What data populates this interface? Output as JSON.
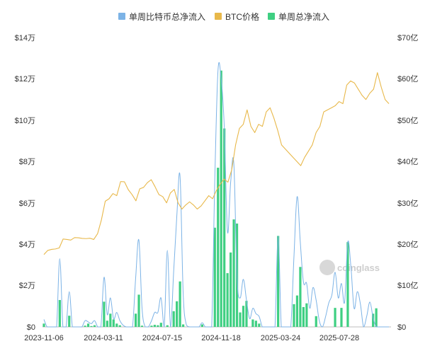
{
  "chart_data": {
    "type": "bar",
    "legend": [
      {
        "name": "单周比特币总净流入",
        "color": "#7cb3e6"
      },
      {
        "name": "BTC价格",
        "color": "#e8b84a"
      },
      {
        "name": "单周总净流入",
        "color": "#3fcf82"
      }
    ],
    "legend_position": "top-center",
    "grid": false,
    "x_tick_labels": [
      "2023-11-06",
      "2024-03-11",
      "2024-07-15",
      "2024-11-18",
      "2025-03-24",
      "2025-07-28"
    ],
    "x_tick_weeks": [
      0,
      18,
      36,
      54,
      72,
      90
    ],
    "weeks": 110,
    "y_left": {
      "min": 0,
      "max": 140000,
      "ticks": [
        0,
        20000,
        40000,
        60000,
        80000,
        100000,
        120000,
        140000
      ],
      "tick_labels": [
        "$0",
        "$2万",
        "$4万",
        "$6万",
        "$8万",
        "$10万",
        "$12万",
        "$14万"
      ]
    },
    "y_right": {
      "min": 0,
      "max": 70,
      "ticks": [
        0,
        10,
        20,
        30,
        40,
        50,
        60,
        70
      ],
      "tick_labels": [
        "$0",
        "$10亿",
        "$20亿",
        "$30亿",
        "$40亿",
        "$50亿",
        "$60亿",
        "$70亿"
      ]
    },
    "series": [
      {
        "name": "单周总净流入",
        "axis": "right",
        "values": [
          0.8,
          0,
          0,
          0,
          0,
          6.5,
          0,
          0,
          2.7,
          0,
          0,
          0,
          0,
          0.3,
          0.8,
          0.2,
          0.4,
          0,
          0,
          6.1,
          1.5,
          3.2,
          1.8,
          0.8,
          0.4,
          0,
          0,
          0,
          0,
          3.2,
          7.8,
          0.3,
          0,
          0,
          0.3,
          0.5,
          0.4,
          1,
          0,
          0.4,
          0,
          3.8,
          6.2,
          11,
          0.6,
          0,
          0,
          0,
          0,
          0,
          0.6,
          0,
          0,
          0,
          24,
          38.5,
          62,
          48,
          13,
          18,
          26,
          25,
          3.5,
          5.1,
          6.3,
          0,
          1.8,
          1.5,
          0.8,
          0,
          0,
          0,
          0,
          0,
          22,
          0,
          0,
          0,
          0,
          5.5,
          7.6,
          14.5,
          4.8,
          5.7,
          0,
          0,
          2.6,
          0,
          0,
          0,
          0,
          0,
          4.6,
          0,
          4.6,
          0,
          20.5,
          0,
          0,
          0,
          0,
          0,
          0,
          0,
          3.2,
          4.5,
          0,
          0,
          0,
          0,
          0,
          0,
          0,
          0,
          0,
          0,
          0.3,
          0,
          0,
          0,
          0,
          0,
          0
        ],
        "color": "#3fcf82"
      },
      {
        "name": "单周比特币总净流入",
        "axis": "right",
        "values": [
          1.8,
          0,
          0,
          0,
          0,
          16.5,
          0,
          0,
          8.5,
          0,
          0,
          0,
          0,
          1.5,
          1.2,
          0.8,
          1.5,
          0,
          0,
          12,
          3,
          7,
          2,
          3.5,
          1.5,
          0.4,
          0,
          0,
          0,
          12,
          21,
          4.5,
          0,
          0,
          1.5,
          3.5,
          3.5,
          7,
          0,
          18.5,
          0,
          13.5,
          27,
          36.5,
          8,
          0.5,
          0,
          0,
          0,
          0,
          1,
          0,
          0,
          0,
          36,
          62,
          60,
          48,
          23,
          35,
          39.5,
          12,
          7,
          11.5,
          6.5,
          2,
          4.5,
          3.2,
          2.5,
          0,
          0,
          0,
          0,
          0,
          22,
          0,
          0,
          0,
          0,
          17,
          31.5,
          20.5,
          10.8,
          10.5,
          4.5,
          9.5,
          6.5,
          1.5,
          0,
          2.5,
          5.8,
          7.8,
          13.2,
          7,
          10.5,
          6,
          20.5,
          14.5,
          4.5,
          8.5,
          5.5,
          0,
          2.6,
          6,
          2.2,
          0,
          0,
          0,
          0,
          0,
          0,
          0,
          0,
          0,
          0,
          0,
          0,
          0,
          0,
          0,
          0,
          0
        ],
        "color": "#7cb3e6"
      },
      {
        "name": "BTC价格",
        "axis": "left",
        "values": [
          35000,
          37000,
          37500,
          37700,
          38200,
          42500,
          42300,
          42000,
          43200,
          43100,
          42800,
          42700,
          42900,
          42300,
          45100,
          51800,
          60800,
          62000,
          64500,
          63500,
          70300,
          70200,
          66400,
          64000,
          61000,
          66800,
          67500,
          69800,
          71200,
          67800,
          64000,
          63000,
          60000,
          64800,
          66500,
          60000,
          57000,
          59000,
          60500,
          59000,
          57000,
          58500,
          61000,
          63500,
          62000,
          66000,
          69000,
          71500,
          70000,
          76000,
          88000,
          96000,
          98000,
          105000,
          97000,
          94000,
          98000,
          97000,
          104000,
          106000,
          101000,
          95000,
          88000,
          86000,
          84000,
          82000,
          80000,
          78000,
          82000,
          85000,
          88000,
          94000,
          97000,
          104000,
          105000,
          106000,
          107000,
          109000,
          108000,
          117000,
          119000,
          118000,
          115000,
          112000,
          110000,
          113000,
          115000,
          123000,
          116000,
          110000,
          108000
        ],
        "color": "#e8b84a"
      }
    ],
    "watermark": "coinglass"
  }
}
